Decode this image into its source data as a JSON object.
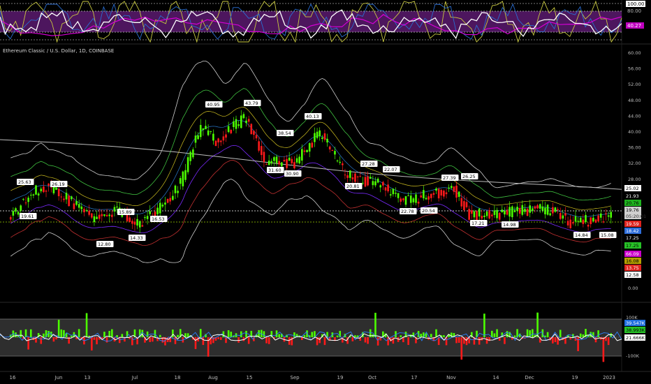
{
  "symbol_title": "Ethereum Classic / U.S. Dollar, 1D, COINBASE",
  "colors": {
    "up": "#4cff00",
    "down": "#ff1a1a",
    "rsi_band": "#5a1a6e",
    "rsi_line": "#ffffff",
    "stoch_yellow": "#c8c840",
    "stoch_blue": "#2a6dd0",
    "ma_magenta": "#d400d4",
    "ma_white": "#bdbdbd",
    "band_white": "#cfcfcf",
    "band_green": "#3fbf3f",
    "band_red": "#c23030",
    "band_yellow": "#d0c020",
    "band_purple": "#7a2aff",
    "hline_white": "#ffffff",
    "hline_green": "#9ed400"
  },
  "rsi_panel": {
    "axis_labels": [
      "100.00",
      "80.00",
      "40.27"
    ],
    "current_value": "40.27"
  },
  "price_axis": {
    "ticks": [
      "60.00",
      "56.00",
      "52.00",
      "48.00",
      "44.00",
      "40.00",
      "36.00",
      "32.00",
      "28.00",
      "24.00",
      "0.00"
    ],
    "badges": [
      {
        "text": "25.02",
        "bg": "#ffffff",
        "fg": "#000000"
      },
      {
        "text": "21.93",
        "bg": "#000000",
        "fg": "#ffffff"
      },
      {
        "text": "20.76",
        "bg": "#1fb41f",
        "fg": "#000000"
      },
      {
        "text": "19.76",
        "bg": "#d0d0d0",
        "fg": "#000000"
      },
      {
        "text": "05:20:01",
        "bg": "#d0d0d0",
        "fg": "#333333"
      },
      {
        "text": "19.59",
        "bg": "#e0241f",
        "fg": "#ffffff"
      },
      {
        "text": "18.42",
        "bg": "#2f6fdc",
        "fg": "#ffffff"
      },
      {
        "text": "17.25",
        "bg": "#000000",
        "fg": "#ffffff"
      },
      {
        "text": "17.25",
        "bg": "#27c227",
        "fg": "#000000"
      },
      {
        "text": "66.09",
        "bg": "#cc00cc",
        "fg": "#ffffff"
      },
      {
        "text": "16.08",
        "bg": "#b5a000",
        "fg": "#000000"
      },
      {
        "text": "13.75",
        "bg": "#e0241f",
        "fg": "#ffffff"
      },
      {
        "text": "12.58",
        "bg": "#ffffff",
        "fg": "#000000"
      }
    ]
  },
  "volume_panel": {
    "axis_labels": [
      "100K",
      "-100K"
    ],
    "badges": [
      {
        "text": "39.547K",
        "bg": "#1f6fe0",
        "fg": "#ffffff"
      },
      {
        "text": "38.993K",
        "bg": "#27c227",
        "fg": "#000000"
      },
      {
        "text": "21.666K",
        "bg": "#ffffff",
        "fg": "#000000"
      }
    ]
  },
  "time_axis": {
    "labels": [
      "16",
      "Jun",
      "13",
      "Jul",
      "18",
      "Aug",
      "15",
      "Sep",
      "19",
      "Oct",
      "17",
      "Nov",
      "14",
      "Dec",
      "19",
      "2023"
    ]
  },
  "chart_data": {
    "type": "candlestick",
    "title": "Ethereum Classic / U.S. Dollar, 1D, COINBASE",
    "y_range_main": [
      18,
      60
    ],
    "close_points": [
      {
        "x": "2022-05-16",
        "y": 23.0
      },
      {
        "x": "2022-05-25",
        "y": 26.5
      },
      {
        "x": "2022-06-01",
        "y": 24.5
      },
      {
        "x": "2022-06-13",
        "y": 18.5
      },
      {
        "x": "2022-06-22",
        "y": 20.5
      },
      {
        "x": "2022-07-01",
        "y": 17.2
      },
      {
        "x": "2022-07-08",
        "y": 19.5
      },
      {
        "x": "2022-07-18",
        "y": 27.5
      },
      {
        "x": "2022-07-26",
        "y": 42.0
      },
      {
        "x": "2022-08-01",
        "y": 38.0
      },
      {
        "x": "2022-08-13",
        "y": 44.0
      },
      {
        "x": "2022-08-20",
        "y": 33.0
      },
      {
        "x": "2022-09-01",
        "y": 32.5
      },
      {
        "x": "2022-09-08",
        "y": 38.0
      },
      {
        "x": "2022-09-12",
        "y": 40.0
      },
      {
        "x": "2022-09-20",
        "y": 30.5
      },
      {
        "x": "2022-09-28",
        "y": 28.0
      },
      {
        "x": "2022-10-04",
        "y": 27.5
      },
      {
        "x": "2022-10-13",
        "y": 22.8
      },
      {
        "x": "2022-10-25",
        "y": 24.5
      },
      {
        "x": "2022-11-03",
        "y": 26.0
      },
      {
        "x": "2022-11-09",
        "y": 19.5
      },
      {
        "x": "2022-11-22",
        "y": 19.5
      },
      {
        "x": "2022-12-05",
        "y": 20.7
      },
      {
        "x": "2022-12-14",
        "y": 20.0
      },
      {
        "x": "2022-12-19",
        "y": 17.5
      },
      {
        "x": "2022-12-30",
        "y": 18.0
      },
      {
        "x": "2023-01-04",
        "y": 19.76
      }
    ],
    "peak_labels": [
      "25.63",
      "26.19",
      "19.61",
      "12.80",
      "14.33",
      "15.89",
      "16.53",
      "40.95",
      "43.79",
      "38.54",
      "40.13",
      "31.60",
      "30.90",
      "27.28",
      "22.07",
      "20.81",
      "27.39",
      "26.25",
      "22.78",
      "20.54",
      "17.21",
      "14.98",
      "14.84",
      "15.08"
    ],
    "reference_lines": [
      {
        "name": "",
        "value": 21.93,
        "style": "dotted",
        "color": "#ffffff"
      },
      {
        "name": "",
        "value": 19.59,
        "style": "dotted",
        "color": "#9ed400"
      }
    ],
    "rsi_levels": [
      100.0,
      80.0,
      40.27
    ],
    "volume_scale": [
      "100K",
      "-100K"
    ]
  }
}
